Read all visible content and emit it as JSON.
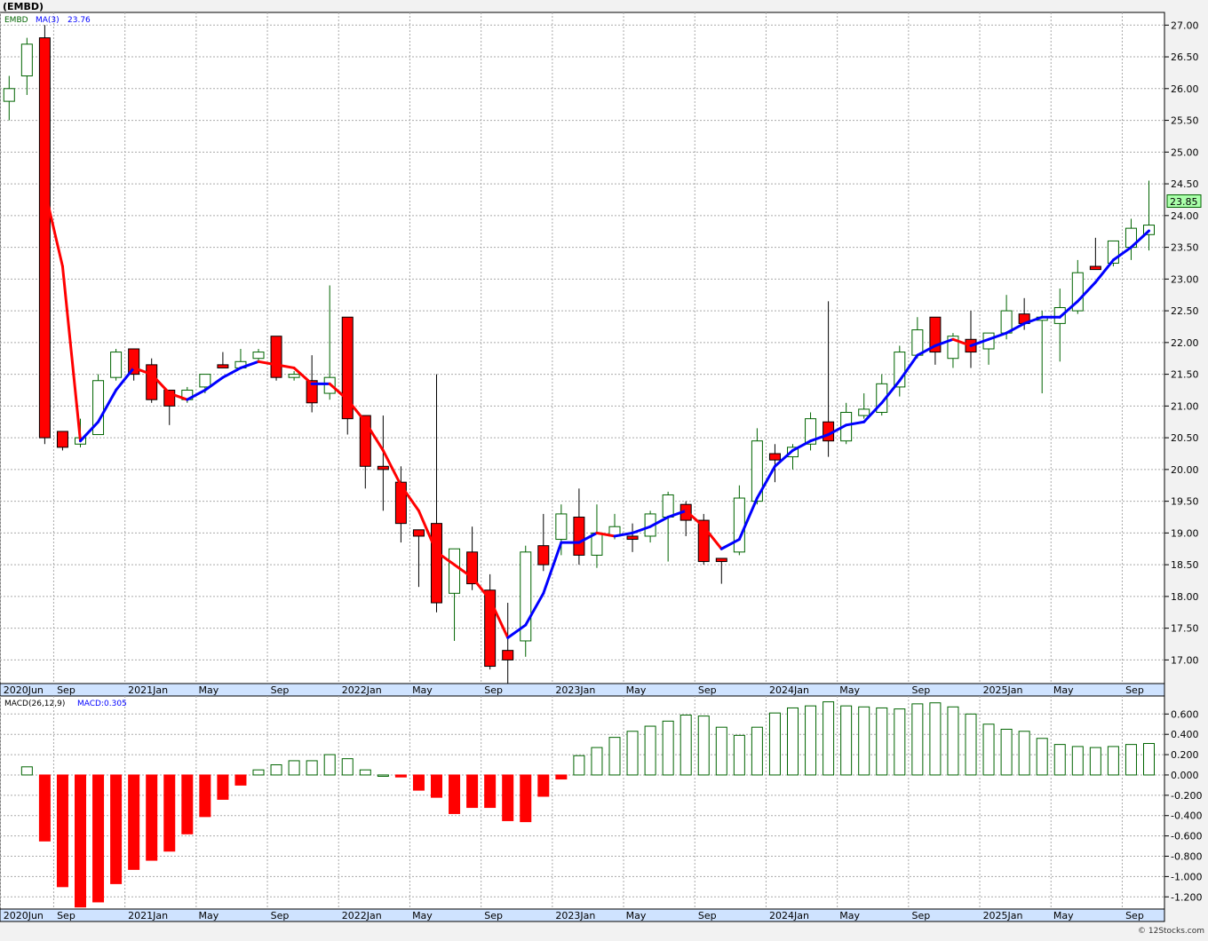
{
  "header": {
    "symbol_title": "(EMBD)",
    "legend_symbol": "EMBD",
    "legend_ma_label": "MA(3)",
    "legend_ma_value": "23.76",
    "macd_label": "MACD(26,12,9)",
    "macd_value": "MACD:0.305",
    "last_price_badge": "23.85",
    "watermark": "© 12Stocks.com"
  },
  "colors": {
    "up": "#006400",
    "down": "#ff0000",
    "ma_up": "#0000ff",
    "ma_down": "#ff0000",
    "grid": "#aaaaaa",
    "badge_bg": "#aaffaa"
  },
  "chart_data": [
    {
      "type": "candlestick",
      "name": "price",
      "ylim": [
        16.6,
        27.2
      ],
      "yticks": [
        "17.00",
        "17.50",
        "18.00",
        "18.50",
        "19.00",
        "19.50",
        "20.00",
        "20.50",
        "21.00",
        "21.50",
        "22.00",
        "22.50",
        "23.00",
        "23.50",
        "24.00",
        "24.50",
        "25.00",
        "25.50",
        "26.00",
        "26.50",
        "27.00"
      ],
      "xticks": [
        "2020Jun",
        "Sep",
        "2021Jan",
        "May",
        "Sep",
        "2022Jan",
        "May",
        "Sep",
        "2023Jan",
        "May",
        "Sep",
        "2024Jan",
        "May",
        "Sep",
        "2025Jan",
        "May",
        "Sep"
      ],
      "xtick_month_index": [
        0,
        3,
        7,
        11,
        15,
        19,
        23,
        27,
        31,
        35,
        39,
        43,
        47,
        51,
        55,
        59,
        63
      ],
      "candles": [
        {
          "o": 25.8,
          "h": 26.2,
          "l": 25.5,
          "c": 26.0
        },
        {
          "o": 26.2,
          "h": 26.8,
          "l": 25.9,
          "c": 26.7
        },
        {
          "o": 26.8,
          "h": 27.0,
          "l": 20.4,
          "c": 20.5
        },
        {
          "o": 20.6,
          "h": 20.6,
          "l": 20.3,
          "c": 20.35
        },
        {
          "o": 20.4,
          "h": 20.8,
          "l": 20.35,
          "c": 20.5
        },
        {
          "o": 20.55,
          "h": 21.5,
          "l": 20.55,
          "c": 21.4
        },
        {
          "o": 21.45,
          "h": 21.9,
          "l": 21.4,
          "c": 21.85
        },
        {
          "o": 21.9,
          "h": 21.9,
          "l": 21.4,
          "c": 21.5
        },
        {
          "o": 21.65,
          "h": 21.75,
          "l": 21.05,
          "c": 21.1
        },
        {
          "o": 21.25,
          "h": 21.25,
          "l": 20.7,
          "c": 21.0
        },
        {
          "o": 21.1,
          "h": 21.3,
          "l": 21.05,
          "c": 21.25
        },
        {
          "o": 21.3,
          "h": 21.5,
          "l": 21.2,
          "c": 21.5
        },
        {
          "o": 21.65,
          "h": 21.85,
          "l": 21.6,
          "c": 21.6
        },
        {
          "o": 21.6,
          "h": 21.9,
          "l": 21.6,
          "c": 21.7
        },
        {
          "o": 21.75,
          "h": 21.9,
          "l": 21.7,
          "c": 21.85
        },
        {
          "o": 22.1,
          "h": 22.1,
          "l": 21.4,
          "c": 21.45
        },
        {
          "o": 21.45,
          "h": 21.55,
          "l": 21.4,
          "c": 21.5
        },
        {
          "o": 21.4,
          "h": 21.8,
          "l": 20.9,
          "c": 21.05
        },
        {
          "o": 21.2,
          "h": 22.9,
          "l": 21.1,
          "c": 21.45
        },
        {
          "o": 22.4,
          "h": 22.4,
          "l": 20.55,
          "c": 20.8
        },
        {
          "o": 20.85,
          "h": 20.85,
          "l": 19.7,
          "c": 20.05
        },
        {
          "o": 20.05,
          "h": 20.85,
          "l": 19.35,
          "c": 20.0
        },
        {
          "o": 19.8,
          "h": 20.05,
          "l": 18.85,
          "c": 19.15
        },
        {
          "o": 19.05,
          "h": 19.05,
          "l": 18.15,
          "c": 18.95
        },
        {
          "o": 19.15,
          "h": 21.5,
          "l": 17.75,
          "c": 17.9
        },
        {
          "o": 18.05,
          "h": 18.75,
          "l": 17.3,
          "c": 18.75
        },
        {
          "o": 18.7,
          "h": 19.1,
          "l": 18.1,
          "c": 18.2
        },
        {
          "o": 18.1,
          "h": 18.35,
          "l": 16.85,
          "c": 16.9
        },
        {
          "o": 17.15,
          "h": 17.9,
          "l": 16.6,
          "c": 17.0
        },
        {
          "o": 17.3,
          "h": 18.8,
          "l": 17.05,
          "c": 18.7
        },
        {
          "o": 18.8,
          "h": 19.3,
          "l": 18.4,
          "c": 18.5
        },
        {
          "o": 18.9,
          "h": 19.45,
          "l": 18.65,
          "c": 19.3
        },
        {
          "o": 19.25,
          "h": 19.7,
          "l": 18.5,
          "c": 18.65
        },
        {
          "o": 18.65,
          "h": 19.45,
          "l": 18.45,
          "c": 19.0
        },
        {
          "o": 18.95,
          "h": 19.3,
          "l": 18.9,
          "c": 19.1
        },
        {
          "o": 18.95,
          "h": 19.15,
          "l": 18.7,
          "c": 18.9
        },
        {
          "o": 18.95,
          "h": 19.35,
          "l": 18.85,
          "c": 19.3
        },
        {
          "o": 19.25,
          "h": 19.65,
          "l": 18.55,
          "c": 19.6
        },
        {
          "o": 19.45,
          "h": 19.5,
          "l": 18.95,
          "c": 19.2
        },
        {
          "o": 19.2,
          "h": 19.3,
          "l": 18.5,
          "c": 18.55
        },
        {
          "o": 18.6,
          "h": 18.6,
          "l": 18.2,
          "c": 18.55
        },
        {
          "o": 18.7,
          "h": 19.75,
          "l": 18.65,
          "c": 19.55
        },
        {
          "o": 19.5,
          "h": 20.65,
          "l": 19.45,
          "c": 20.45
        },
        {
          "o": 20.25,
          "h": 20.4,
          "l": 19.8,
          "c": 20.15
        },
        {
          "o": 20.2,
          "h": 20.4,
          "l": 20.0,
          "c": 20.35
        },
        {
          "o": 20.4,
          "h": 20.9,
          "l": 20.3,
          "c": 20.8
        },
        {
          "o": 20.75,
          "h": 22.65,
          "l": 20.2,
          "c": 20.45
        },
        {
          "o": 20.45,
          "h": 21.05,
          "l": 20.4,
          "c": 20.9
        },
        {
          "o": 20.85,
          "h": 21.2,
          "l": 20.8,
          "c": 20.95
        },
        {
          "o": 20.9,
          "h": 21.5,
          "l": 20.85,
          "c": 21.35
        },
        {
          "o": 21.3,
          "h": 21.95,
          "l": 21.15,
          "c": 21.85
        },
        {
          "o": 21.8,
          "h": 22.4,
          "l": 21.75,
          "c": 22.2
        },
        {
          "o": 22.4,
          "h": 22.4,
          "l": 21.65,
          "c": 21.85
        },
        {
          "o": 21.75,
          "h": 22.15,
          "l": 21.6,
          "c": 22.1
        },
        {
          "o": 22.05,
          "h": 22.5,
          "l": 21.6,
          "c": 21.85
        },
        {
          "o": 21.9,
          "h": 22.1,
          "l": 21.65,
          "c": 22.15
        },
        {
          "o": 22.15,
          "h": 22.75,
          "l": 22.05,
          "c": 22.5
        },
        {
          "o": 22.45,
          "h": 22.7,
          "l": 22.2,
          "c": 22.3
        },
        {
          "o": 22.35,
          "h": 22.5,
          "l": 21.2,
          "c": 22.4
        },
        {
          "o": 22.3,
          "h": 22.85,
          "l": 21.7,
          "c": 22.55
        },
        {
          "o": 22.5,
          "h": 23.3,
          "l": 22.45,
          "c": 23.1
        },
        {
          "o": 23.2,
          "h": 23.65,
          "l": 23.15,
          "c": 23.15
        },
        {
          "o": 23.25,
          "h": 23.6,
          "l": 23.2,
          "c": 23.6
        },
        {
          "o": 23.5,
          "h": 23.95,
          "l": 23.3,
          "c": 23.8
        },
        {
          "o": 23.7,
          "h": 24.55,
          "l": 23.45,
          "c": 23.85
        }
      ],
      "ma": [
        null,
        null,
        24.4,
        23.2,
        20.45,
        20.75,
        21.25,
        21.6,
        21.5,
        21.2,
        21.1,
        21.25,
        21.45,
        21.6,
        21.7,
        21.65,
        21.6,
        21.35,
        21.35,
        21.1,
        20.75,
        20.3,
        19.75,
        19.35,
        18.7,
        18.5,
        18.3,
        17.95,
        17.35,
        17.55,
        18.05,
        18.85,
        18.85,
        19.0,
        18.95,
        19.0,
        19.1,
        19.25,
        19.35,
        19.1,
        18.75,
        18.9,
        19.55,
        20.05,
        20.3,
        20.45,
        20.55,
        20.7,
        20.75,
        21.05,
        21.4,
        21.8,
        21.95,
        22.05,
        21.95,
        22.05,
        22.15,
        22.3,
        22.4,
        22.4,
        22.65,
        22.95,
        23.3,
        23.5,
        23.76
      ]
    },
    {
      "type": "bar",
      "name": "MACD(26,12,9)",
      "ylim": [
        -1.32,
        0.76
      ],
      "yticks": [
        "-1.200",
        "-1.000",
        "-0.800",
        "-0.600",
        "-0.400",
        "-0.200",
        "0.000",
        "0.200",
        "0.400",
        "0.600"
      ],
      "values": [
        null,
        0.08,
        -0.65,
        -1.1,
        -1.3,
        -1.25,
        -1.07,
        -0.93,
        -0.84,
        -0.75,
        -0.58,
        -0.41,
        -0.24,
        -0.1,
        0.05,
        0.1,
        0.14,
        0.14,
        0.2,
        0.16,
        0.05,
        0.0,
        -0.02,
        -0.15,
        -0.22,
        -0.38,
        -0.32,
        -0.32,
        -0.45,
        -0.46,
        -0.21,
        -0.04,
        0.19,
        0.27,
        0.37,
        0.43,
        0.48,
        0.53,
        0.59,
        0.58,
        0.47,
        0.39,
        0.47,
        0.61,
        0.66,
        0.68,
        0.72,
        0.68,
        0.67,
        0.66,
        0.65,
        0.7,
        0.71,
        0.67,
        0.6,
        0.5,
        0.45,
        0.43,
        0.36,
        0.3,
        0.28,
        0.27,
        0.28,
        0.3,
        0.31
      ]
    }
  ]
}
